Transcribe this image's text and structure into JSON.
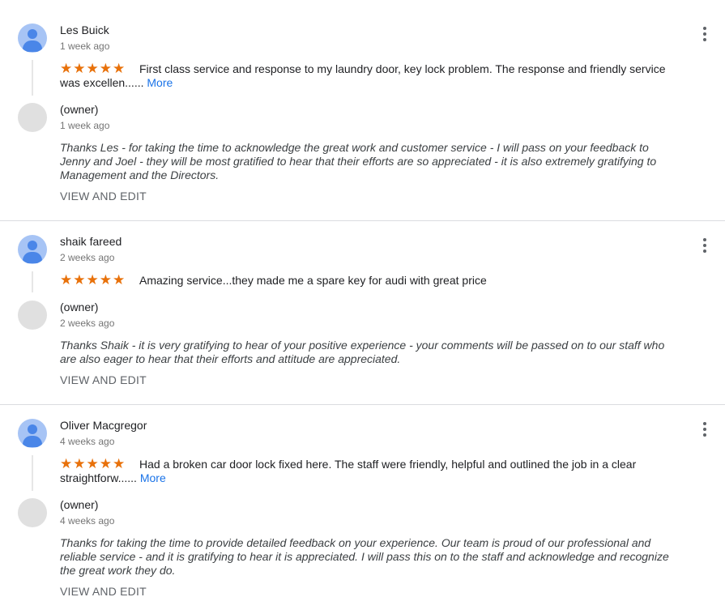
{
  "reviews": [
    {
      "author": "Les Buick",
      "time": "1 week ago",
      "stars": "★★★★★",
      "text_line1": "First class service and response to my laundry door, key lock problem. The response and friendly service",
      "text_line2": "was excellen......",
      "more": "More",
      "owner_label": "(owner)",
      "owner_time": "1 week ago",
      "reply": "Thanks Les - for taking the time to acknowledge the great work and customer service - I will pass on your feedback to Jenny and Joel - they will be most gratified to hear that their efforts are so appreciated - it is also extremely gratifying to Management and the Directors.",
      "action": "VIEW AND EDIT"
    },
    {
      "author": "shaik fareed",
      "time": "2 weeks ago",
      "stars": "★★★★★",
      "text_line1": "Amazing service...they made me a spare key for audi with great price",
      "text_line2": "",
      "more": "",
      "owner_label": "(owner)",
      "owner_time": "2 weeks ago",
      "reply": "Thanks Shaik - it is very gratifying to hear of your positive experience - your comments will be passed on to our staff who are also eager to hear that their efforts and attitude are appreciated.",
      "action": "VIEW AND EDIT"
    },
    {
      "author": "Oliver Macgregor",
      "time": "4 weeks ago",
      "stars": "★★★★★",
      "text_line1": "Had a broken car door lock fixed here. The staff were friendly, helpful and outlined the job in a clear",
      "text_line2": "straightforw......",
      "more": "More",
      "owner_label": "(owner)",
      "owner_time": "4 weeks ago",
      "reply": "Thanks for taking the time to provide detailed feedback on your experience. Our team is proud of our professional and reliable service - and it is gratifying to hear it is appreciated. I will pass this on to the staff and acknowledge and recognize the great work they do.",
      "action": "VIEW AND EDIT"
    }
  ],
  "colors": {
    "star": "#e8710a",
    "link": "#1a73e8",
    "avatar": "#4a86e8"
  }
}
